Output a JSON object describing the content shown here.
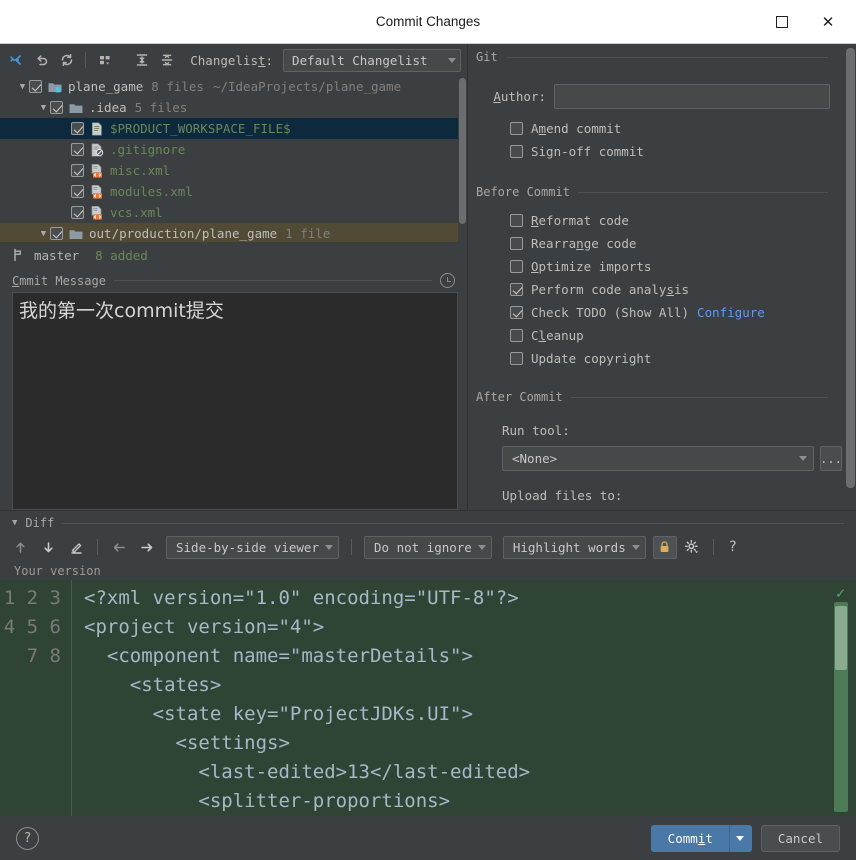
{
  "window": {
    "title": "Commit Changes",
    "maximize_icon": "maximize-icon",
    "close_label": "✕"
  },
  "toolbar": {
    "changelist_label": "Changelist:",
    "changelist_label_pre": "Changelis",
    "changelist_label_accel": "t",
    "changelist_label_post": ":",
    "changelist_value": "Default Changelist",
    "buttons": [
      {
        "name": "show-diff-icon",
        "title": "Show Diff"
      },
      {
        "name": "revert-icon",
        "title": "Revert"
      },
      {
        "name": "refresh-icon",
        "title": "Refresh"
      },
      {
        "name": "group-by-icon",
        "title": "Group By"
      },
      {
        "name": "expand-all-icon",
        "title": "Expand All"
      },
      {
        "name": "collapse-all-icon",
        "title": "Collapse All"
      }
    ]
  },
  "tree": {
    "rows": [
      {
        "indent": 0,
        "arrow": "▼",
        "checked": true,
        "icon": "project-folder-icon",
        "name": "plane_game",
        "name_color": "plain",
        "meta": "8 files",
        "path": "~/IdeaProjects/plane_game",
        "state": "normal"
      },
      {
        "indent": 1,
        "arrow": "▼",
        "checked": true,
        "icon": "folder-icon",
        "name": ".idea",
        "name_color": "plain",
        "meta": "5 files",
        "path": "",
        "state": "normal"
      },
      {
        "indent": 2,
        "arrow": "",
        "checked": true,
        "icon": "workspace-file-icon",
        "name": "$PRODUCT_WORKSPACE_FILE$",
        "name_color": "green",
        "meta": "",
        "path": "",
        "state": "selected"
      },
      {
        "indent": 2,
        "arrow": "",
        "checked": true,
        "icon": "gitignore-icon",
        "name": ".gitignore",
        "name_color": "green",
        "meta": "",
        "path": "",
        "state": "normal"
      },
      {
        "indent": 2,
        "arrow": "",
        "checked": true,
        "icon": "xml-file-icon",
        "name": "misc.xml",
        "name_color": "green",
        "meta": "",
        "path": "",
        "state": "normal"
      },
      {
        "indent": 2,
        "arrow": "",
        "checked": true,
        "icon": "xml-file-icon",
        "name": "modules.xml",
        "name_color": "green",
        "meta": "",
        "path": "",
        "state": "normal"
      },
      {
        "indent": 2,
        "arrow": "",
        "checked": true,
        "icon": "xml-file-icon",
        "name": "vcs.xml",
        "name_color": "green",
        "meta": "",
        "path": "",
        "state": "normal"
      },
      {
        "indent": 1,
        "arrow": "▼",
        "checked": true,
        "icon": "folder-icon",
        "name": "out/production/plane_game",
        "name_color": "plain",
        "meta": "1 file",
        "path": "",
        "state": "shaded"
      }
    ]
  },
  "branch": {
    "name": "master",
    "added": "8 added"
  },
  "commit_message": {
    "header_pre": "C",
    "header_accel": "o",
    "header_post": "mmit Message",
    "header": "Commit Message",
    "history_icon": "clock-icon",
    "value": "我的第一次commit提交"
  },
  "git": {
    "section_title": "Git",
    "author_label": "Author:",
    "author_label_accel": "A",
    "author_label_rest": "uthor:",
    "author_value": "",
    "checkboxes": [
      {
        "label": "Amend commit",
        "pre": "A",
        "accel": "m",
        "post": "end commit",
        "checked": false,
        "name": "amend-commit-checkbox"
      },
      {
        "label": "Sign-off commit",
        "pre": "Sign-off commit",
        "accel": "",
        "post": "",
        "checked": false,
        "name": "sign-off-commit-checkbox"
      }
    ]
  },
  "before_commit": {
    "section_title": "Before Commit",
    "checkboxes": [
      {
        "pre": "",
        "accel": "R",
        "post": "eformat code",
        "checked": false,
        "name": "reformat-code-checkbox"
      },
      {
        "pre": "Rearra",
        "accel": "n",
        "post": "ge code",
        "checked": false,
        "name": "rearrange-code-checkbox"
      },
      {
        "pre": "",
        "accel": "O",
        "post": "ptimize imports",
        "checked": false,
        "name": "optimize-imports-checkbox"
      },
      {
        "pre": "Perform code analy",
        "accel": "s",
        "post": "is",
        "checked": true,
        "name": "perform-code-analysis-checkbox"
      },
      {
        "pre": "Check TODO (Show All)",
        "accel": "",
        "post": "",
        "checked": true,
        "name": "check-todo-checkbox",
        "link": "Configure"
      },
      {
        "pre": "C",
        "accel": "l",
        "post": "eanup",
        "checked": false,
        "name": "cleanup-checkbox"
      },
      {
        "pre": "Update copyright",
        "accel": "",
        "post": "",
        "checked": false,
        "name": "update-copyright-checkbox"
      }
    ]
  },
  "after_commit": {
    "section_title": "After Commit",
    "run_tool_label": "Run tool:",
    "run_tool_value": "<None>",
    "browse_label": "...",
    "upload_label": "Upload files to:"
  },
  "diff": {
    "section_title": "Diff",
    "collapse_arrow": "▼",
    "viewer_mode": "Side-by-side viewer",
    "ignore_mode": "Do not ignore",
    "highlight_mode": "Highlight words",
    "lock_icon": "lock-icon",
    "settings_icon": "gear-icon",
    "help_label": "?",
    "buttons": [
      {
        "name": "previous-difference-icon",
        "glyph": "↑"
      },
      {
        "name": "next-difference-icon",
        "glyph": "↓"
      },
      {
        "name": "edit-source-icon",
        "glyph": "✎"
      },
      {
        "name": "accept-left-icon",
        "glyph": "←"
      },
      {
        "name": "accept-right-icon",
        "glyph": "→"
      }
    ],
    "pane_label": "Your version",
    "line_numbers": [
      "1",
      "2",
      "3",
      "4",
      "5",
      "6",
      "7",
      "8"
    ],
    "lines": [
      "<?xml version=\"1.0\" encoding=\"UTF-8\"?>",
      "<project version=\"4\">",
      "  <component name=\"masterDetails\">",
      "    <states>",
      "      <state key=\"ProjectJDKs.UI\">",
      "        <settings>",
      "          <last-edited>13</last-edited>",
      "          <splitter-proportions>"
    ]
  },
  "footer": {
    "help_label": "?",
    "commit_pre": "Comm",
    "commit_accel": "i",
    "commit_post": "t",
    "commit_label": "Commit",
    "cancel_label": "Cancel"
  },
  "colors": {
    "accent_blue": "#4a79a8",
    "link_blue": "#589df6",
    "added_green": "#6a8759",
    "diff_bg_green": "#2f4435",
    "selection_blue": "#0d293e",
    "panel_bg": "#3c3f41",
    "editor_bg": "#2b2b2b"
  }
}
